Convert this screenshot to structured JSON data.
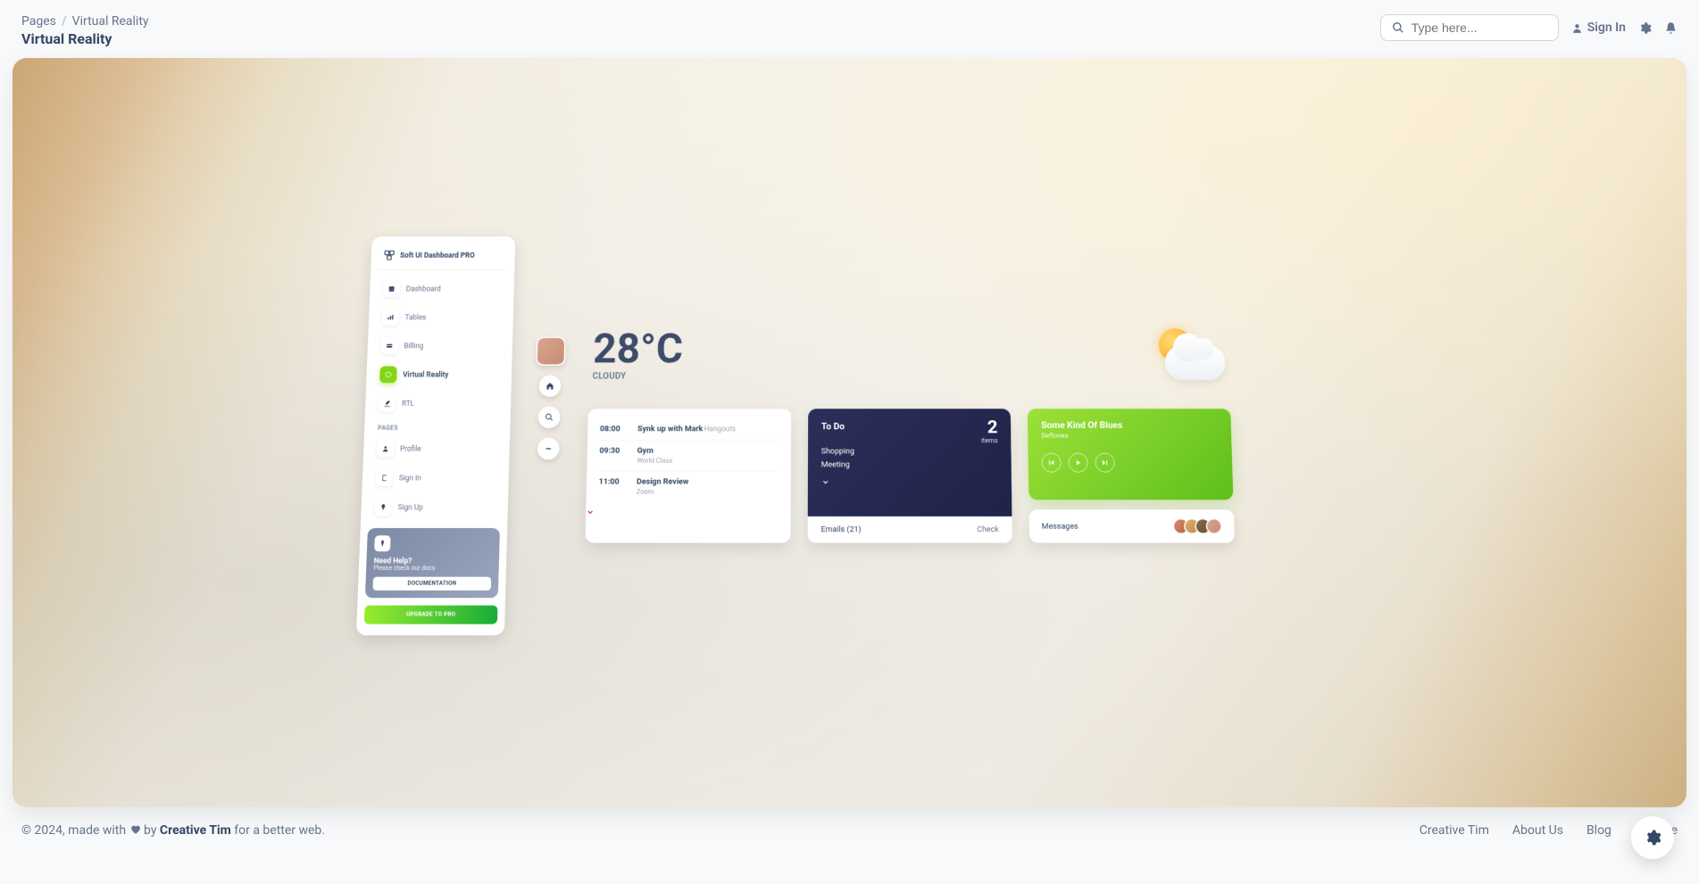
{
  "breadcrumb": {
    "root": "Pages",
    "current": "Virtual Reality"
  },
  "page_title": "Virtual Reality",
  "search": {
    "placeholder": "Type here..."
  },
  "topbar": {
    "signin": "Sign In"
  },
  "sidebar": {
    "brand": "Soft UI Dashboard PRO",
    "items": [
      {
        "label": "Dashboard"
      },
      {
        "label": "Tables"
      },
      {
        "label": "Billing"
      },
      {
        "label": "Virtual Reality"
      },
      {
        "label": "RTL"
      }
    ],
    "pages_label": "PAGES",
    "pages": [
      {
        "label": "Profile"
      },
      {
        "label": "Sign In"
      },
      {
        "label": "Sign Up"
      }
    ],
    "help": {
      "title": "Need Help?",
      "sub": "Please check our docs",
      "doc_btn": "DOCUMENTATION"
    },
    "upgrade": "UPGRADE TO PRO"
  },
  "weather": {
    "temp": "28°C",
    "condition": "CLOUDY"
  },
  "schedule": [
    {
      "time": "08:00",
      "title": "Synk up with Mark",
      "tag": "Hangouts",
      "sub": ""
    },
    {
      "time": "09:30",
      "title": "Gym",
      "tag": "",
      "sub": "World Class"
    },
    {
      "time": "11:00",
      "title": "Design Review",
      "tag": "",
      "sub": "Zoom"
    }
  ],
  "todo": {
    "title": "To Do",
    "count": "2",
    "count_label": "items",
    "items": [
      "Shopping",
      "Meeting"
    ],
    "emails_label": "Emails (21)",
    "check_label": "Check"
  },
  "music": {
    "title": "Some Kind Of Blues",
    "artist": "Deftones"
  },
  "messages": {
    "label": "Messages"
  },
  "footer": {
    "left_prefix": "© 2024, made with ",
    "left_mid": " by ",
    "brand": "Creative Tim",
    "left_suffix": " for a better web.",
    "links": [
      "Creative Tim",
      "About Us",
      "Blog",
      "License"
    ]
  }
}
